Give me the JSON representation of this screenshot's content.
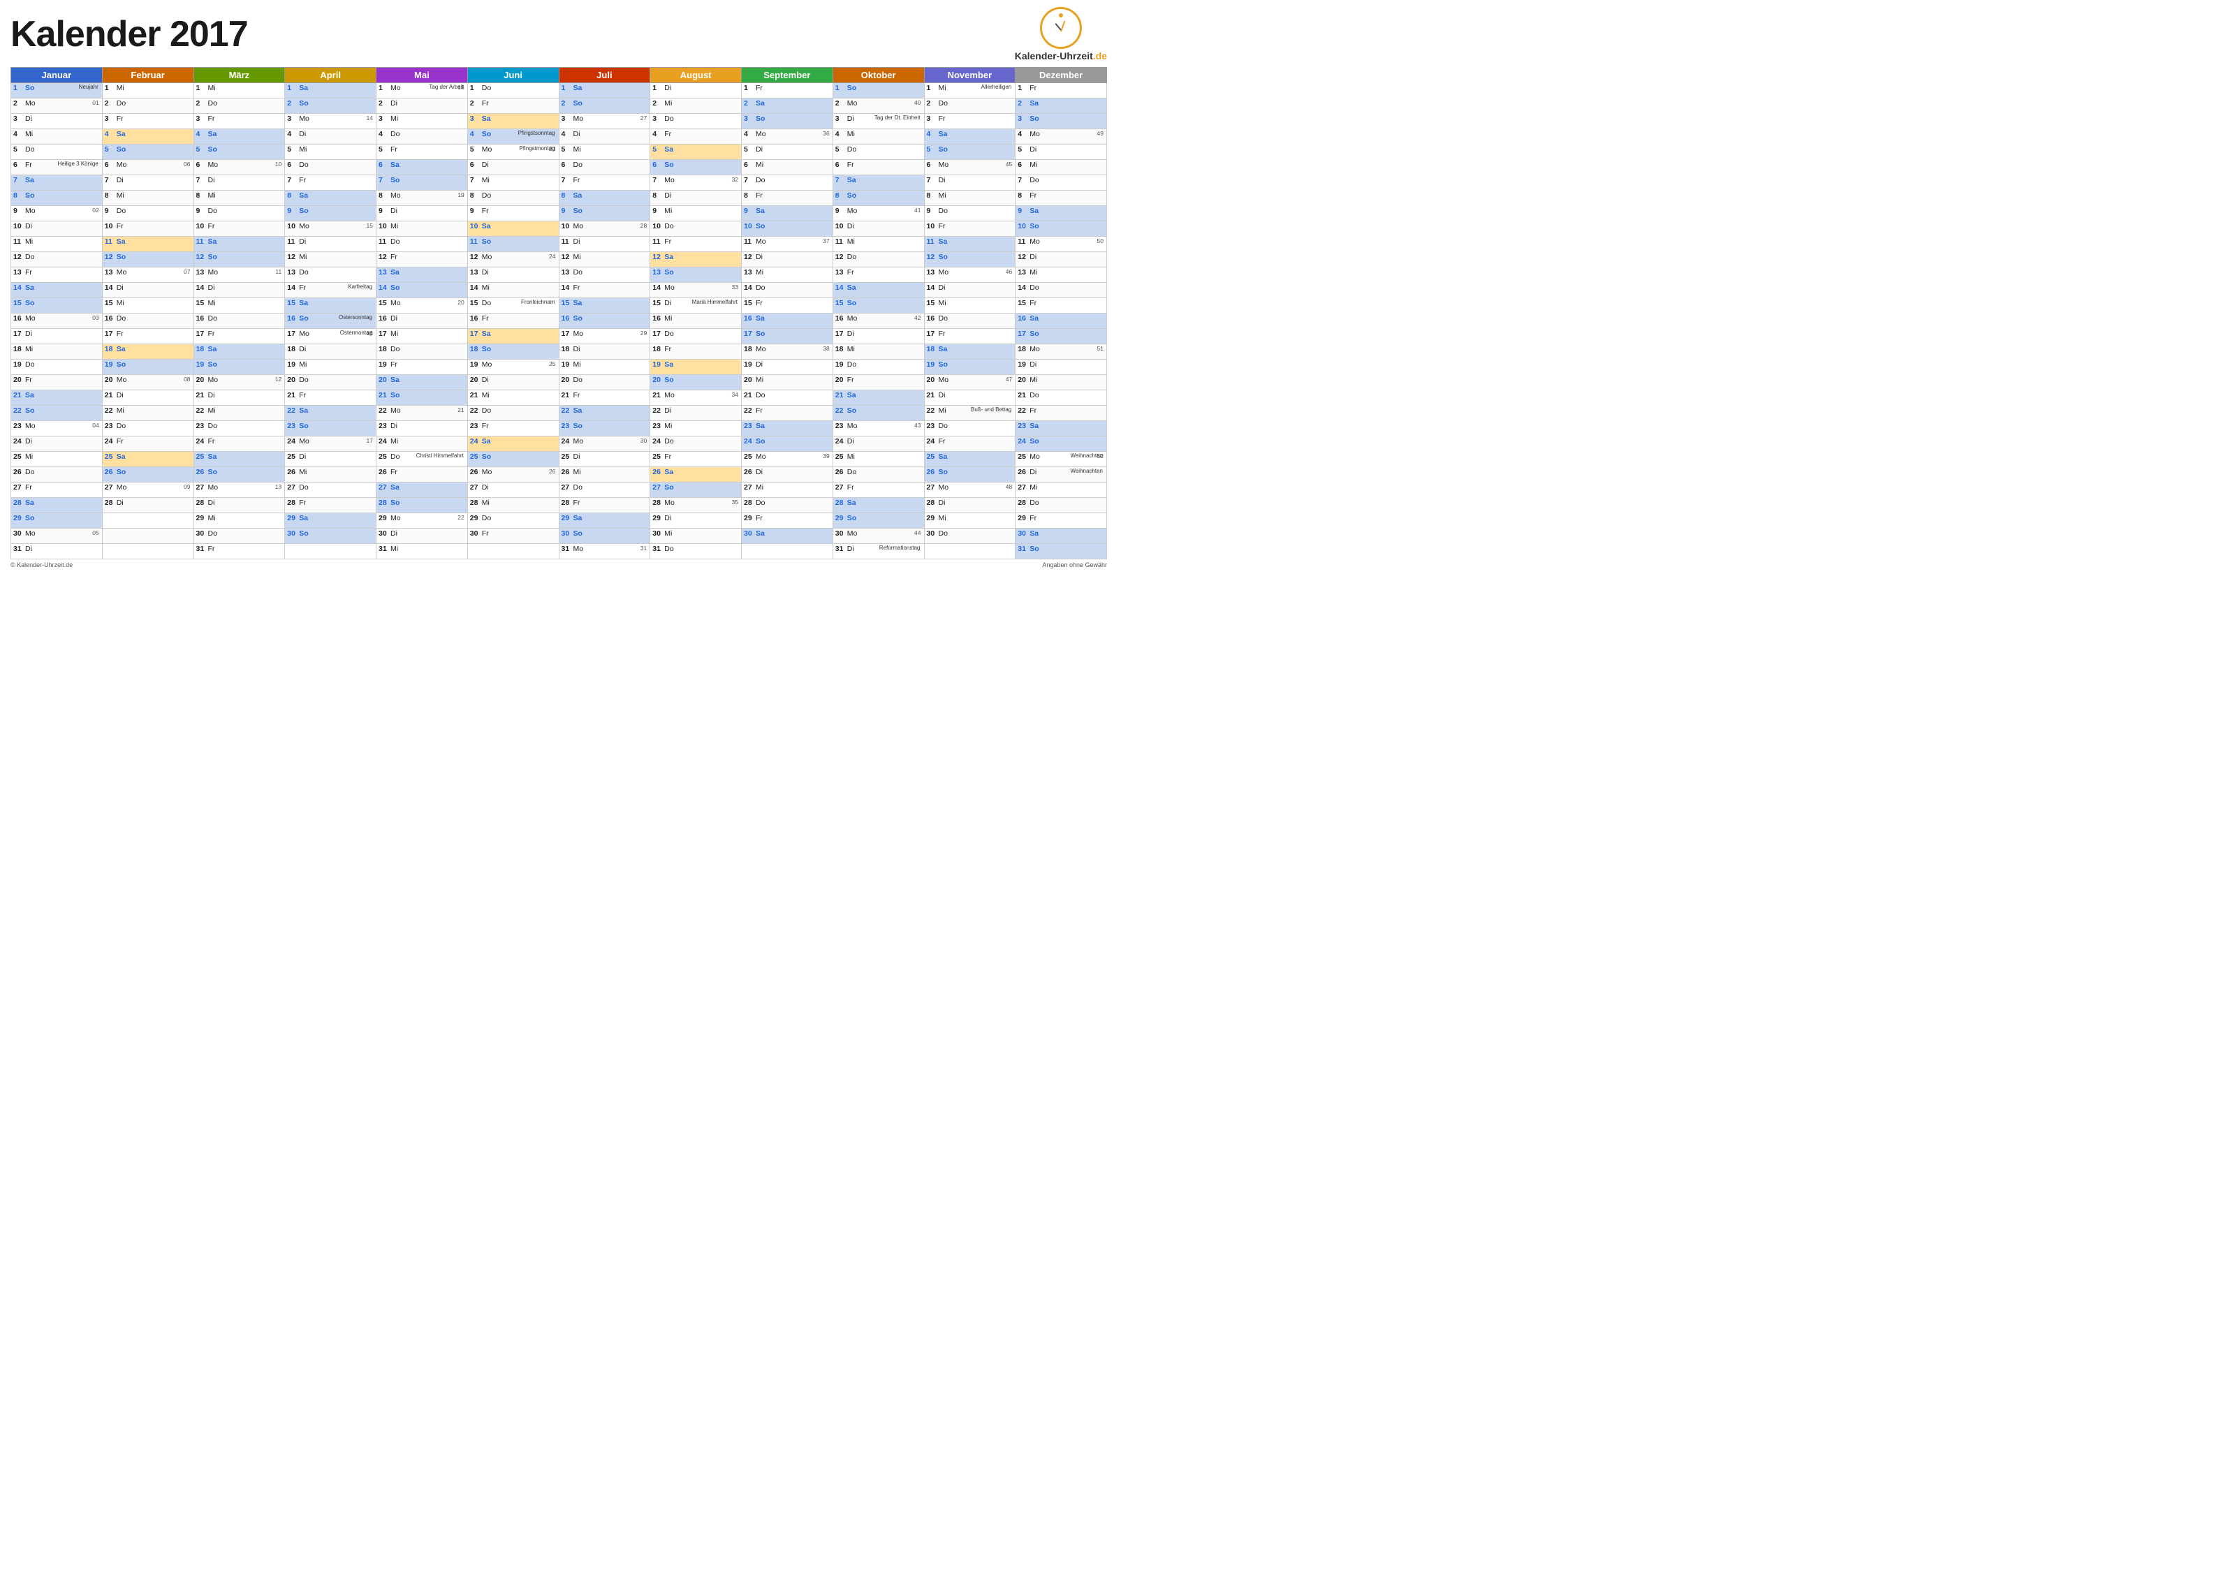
{
  "title": "Kalender 2017",
  "logo": {
    "text": "Kalender-Uhrzeit",
    "domain": ".de"
  },
  "footer": {
    "left": "© Kalender-Uhrzeit.de",
    "right": "Angaben ohne Gewähr"
  },
  "months": [
    "Januar",
    "Februar",
    "März",
    "April",
    "Mai",
    "Juni",
    "Juli",
    "August",
    "September",
    "Oktober",
    "November",
    "Dezember"
  ],
  "month_classes": [
    "month-jan",
    "month-feb",
    "month-mar",
    "month-apr",
    "month-mai",
    "month-jun",
    "month-jul",
    "month-aug",
    "month-sep",
    "month-okt",
    "month-nov",
    "month-dez"
  ]
}
